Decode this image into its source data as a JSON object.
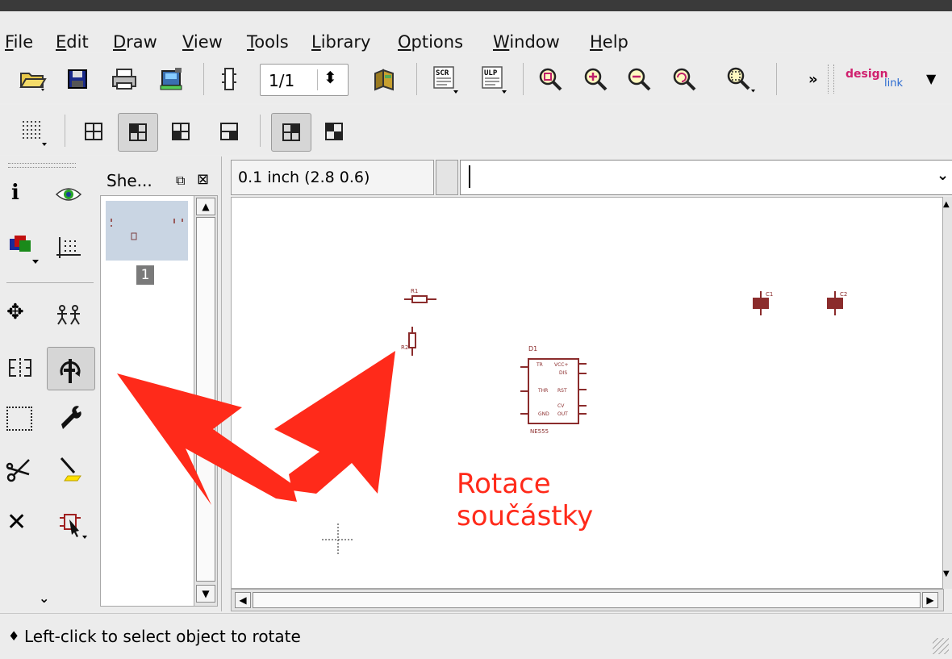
{
  "menubar": {
    "items": [
      {
        "name": "file",
        "label": "File",
        "underline_index": 0
      },
      {
        "name": "edit",
        "label": "Edit",
        "underline_index": 0
      },
      {
        "name": "draw",
        "label": "Draw",
        "underline_index": 0
      },
      {
        "name": "view",
        "label": "View",
        "underline_index": 0
      },
      {
        "name": "tools",
        "label": "Tools",
        "underline_index": 0
      },
      {
        "name": "library",
        "label": "Library",
        "underline_index": 0
      },
      {
        "name": "options",
        "label": "Options",
        "underline_index": 0
      },
      {
        "name": "window",
        "label": "Window",
        "underline_index": 0
      },
      {
        "name": "help",
        "label": "Help",
        "underline_index": 0
      }
    ]
  },
  "toolbar": {
    "sheet_selector_value": "1/1",
    "scr_label": "SCR",
    "ulp_label": "ULP",
    "overflow_glyph": "»",
    "designlink_top": "design",
    "designlink_bottom": "link"
  },
  "sheets": {
    "title": "She...",
    "sheet_number": "1"
  },
  "coordinate": {
    "value": "0.1 inch (2.8 0.6)"
  },
  "command_line": {
    "value": ""
  },
  "schematic": {
    "part_labels": {
      "r1": "R1",
      "r2": "R2",
      "d1": "D1",
      "c1": "C1",
      "c2": "C2",
      "ic_name": "NE555"
    },
    "ic_pins": {
      "tr": "TR",
      "vcc": "VCC+",
      "dis": "DIS",
      "rst": "RST",
      "thr": "THR",
      "cv": "CV",
      "gnd": "GND",
      "out": "OUT"
    }
  },
  "annotation": {
    "line1": "Rotace",
    "line2": "součástky",
    "color": "#ff2a1a"
  },
  "status": {
    "bullet": "♦",
    "message": "Left-click to select object to rotate"
  },
  "colors": {
    "schematic_part": "#8b2c2c",
    "arrow": "#ff2a1a"
  }
}
